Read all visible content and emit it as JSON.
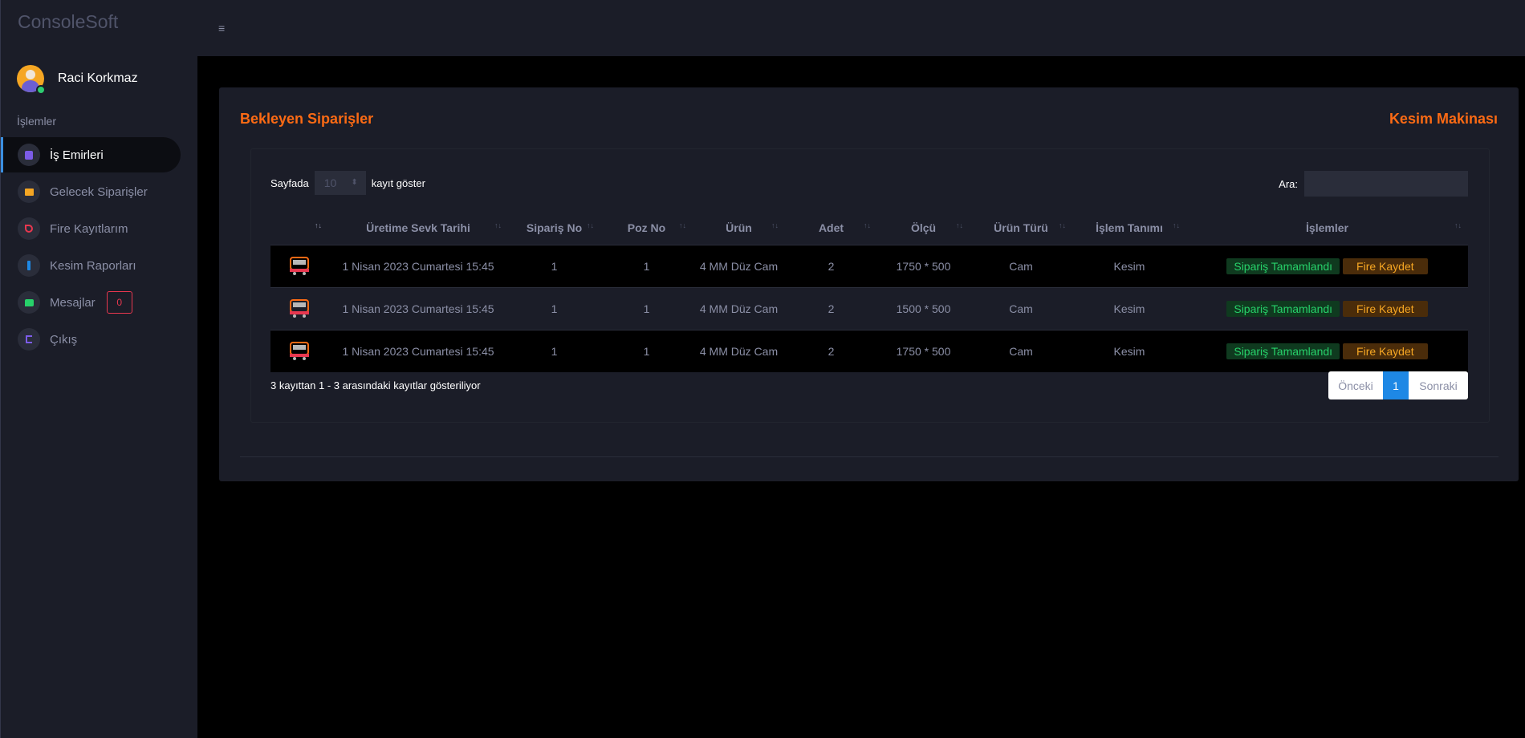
{
  "brand": "ConsoleSoft",
  "user": {
    "name": "Raci Korkmaz"
  },
  "sidebar": {
    "section_label": "İşlemler",
    "items": [
      {
        "label": "İş Emirleri",
        "icon": "orders-icon",
        "icon_color": "#7c5ce8",
        "active": true
      },
      {
        "label": "Gelecek Siparişler",
        "icon": "list-icon",
        "icon_color": "#f5a623"
      },
      {
        "label": "Fire Kayıtlarım",
        "icon": "scissors-icon",
        "icon_color": "#e8374f"
      },
      {
        "label": "Kesim Raporları",
        "icon": "report-icon",
        "icon_color": "#1e88e5"
      },
      {
        "label": "Mesajlar",
        "icon": "message-icon",
        "icon_color": "#27d16a",
        "badge": "0"
      },
      {
        "label": "Çıkış",
        "icon": "logout-icon",
        "icon_color": "#7c5ce8"
      }
    ]
  },
  "card": {
    "title": "Bekleyen Siparişler",
    "right_title": "Kesim Makinası",
    "length": {
      "prefix": "Sayfada",
      "value": "10",
      "suffix": "kayıt göster"
    },
    "search": {
      "label": "Ara:",
      "value": ""
    },
    "columns": [
      "",
      "Üretime Sevk Tarihi",
      "Sipariş No",
      "Poz No",
      "Ürün",
      "Adet",
      "Ölçü",
      "Ürün Türü",
      "İşlem Tanımı",
      "İşlemler"
    ],
    "rows": [
      {
        "date": "1 Nisan 2023 Cumartesi 15:45",
        "order_no": "1",
        "pos_no": "1",
        "product": "4 MM Düz Cam",
        "qty": "2",
        "size": "1750 * 500",
        "type": "Cam",
        "process": "Kesim"
      },
      {
        "date": "1 Nisan 2023 Cumartesi 15:45",
        "order_no": "1",
        "pos_no": "1",
        "product": "4 MM Düz Cam",
        "qty": "2",
        "size": "1500 * 500",
        "type": "Cam",
        "process": "Kesim"
      },
      {
        "date": "1 Nisan 2023 Cumartesi 15:45",
        "order_no": "1",
        "pos_no": "1",
        "product": "4 MM Düz Cam",
        "qty": "2",
        "size": "1750 * 500",
        "type": "Cam",
        "process": "Kesim"
      }
    ],
    "actions": {
      "complete": "Sipariş Tamamlandı",
      "waste": "Fire Kaydet"
    },
    "info": "3 kayıttan 1 - 3 arasındaki kayıtlar gösteriliyor",
    "pager": {
      "prev": "Önceki",
      "current": "1",
      "next": "Sonraki"
    }
  },
  "colors": {
    "accent": "#fb6a14",
    "sidebar_bg": "#1b1d28",
    "complete": "#27d16a",
    "waste": "#f5a623"
  }
}
